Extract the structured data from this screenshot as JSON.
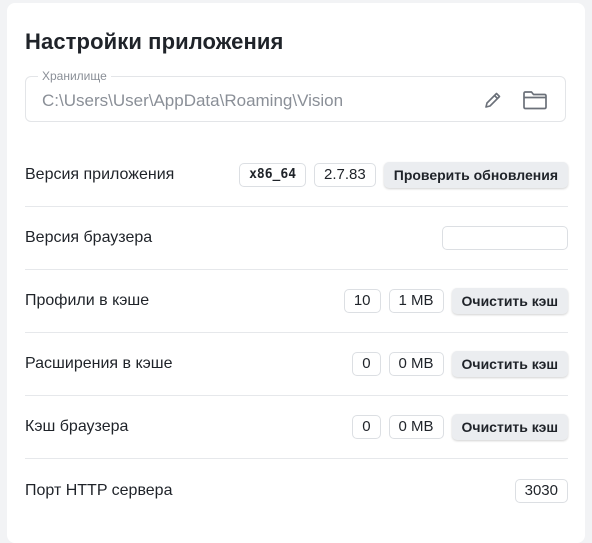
{
  "title": "Настройки приложения",
  "storage": {
    "legend": "Хранилище",
    "path": "C:\\Users\\User\\AppData\\Roaming\\Vision",
    "icons": [
      "pencil-icon",
      "folder-icon"
    ]
  },
  "rows": {
    "app_version": {
      "label": "Версия приложения",
      "arch": "x86_64",
      "version": "2.7.83",
      "button": "Проверить обновления"
    },
    "browser_version": {
      "label": "Версия браузера",
      "value": ""
    },
    "profiles_cache": {
      "label": "Профили в кэше",
      "count": "10",
      "size": "1 MB",
      "button": "Очистить кэш"
    },
    "extensions_cache": {
      "label": "Расширения в кэше",
      "count": "0",
      "size": "0 MB",
      "button": "Очистить кэш"
    },
    "browser_cache": {
      "label": "Кэш браузера",
      "count": "0",
      "size": "0 MB",
      "button": "Очистить кэш"
    },
    "http_port": {
      "label": "Порт HTTP сервера",
      "value": "3030"
    }
  }
}
